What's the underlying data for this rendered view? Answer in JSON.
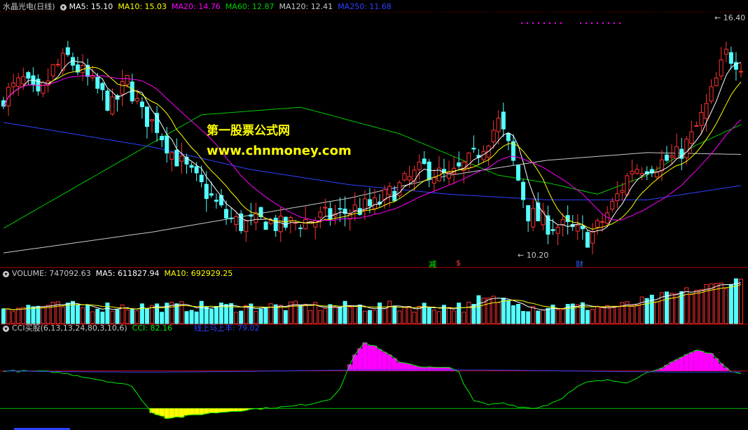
{
  "chart_data": [
    {
      "type": "candlestick",
      "title": "水晶光电(日线)",
      "indicators": [
        {
          "name": "MA5",
          "value": "15.10",
          "color": "#ffffff"
        },
        {
          "name": "MA10",
          "value": "15.03",
          "color": "#ffff00"
        },
        {
          "name": "MA20",
          "value": "14.76",
          "color": "#ff00ff"
        },
        {
          "name": "MA60",
          "value": "12.87",
          "color": "#00cc00"
        },
        {
          "name": "MA120",
          "value": "12.41",
          "color": "#c8c8c8"
        },
        {
          "name": "MA250",
          "value": "11.68",
          "color": "#3040ff"
        }
      ],
      "high_label": "16.40",
      "low_label": "10.20",
      "annotations": [
        "减",
        "$",
        "财"
      ],
      "ylim": [
        10.0,
        16.7
      ],
      "bars": 150,
      "anchors_close": [
        [
          0,
          14.5
        ],
        [
          4,
          14.9
        ],
        [
          7,
          14.4
        ],
        [
          10,
          15.2
        ],
        [
          13,
          15.5
        ],
        [
          18,
          14.8
        ],
        [
          22,
          14.2
        ],
        [
          25,
          14.9
        ],
        [
          28,
          14.0
        ],
        [
          31,
          13.7
        ],
        [
          34,
          13.0
        ],
        [
          38,
          12.4
        ],
        [
          42,
          11.8
        ],
        [
          45,
          11.3
        ],
        [
          48,
          11.1
        ],
        [
          53,
          11.2
        ],
        [
          56,
          11.05
        ],
        [
          59,
          11.15
        ],
        [
          63,
          11.25
        ],
        [
          67,
          11.35
        ],
        [
          71,
          11.5
        ],
        [
          75,
          11.6
        ],
        [
          80,
          12.1
        ],
        [
          85,
          12.6
        ],
        [
          90,
          12.3
        ],
        [
          95,
          12.85
        ],
        [
          100,
          13.8
        ],
        [
          102,
          13.15
        ],
        [
          106,
          11.4
        ],
        [
          110,
          11.1
        ],
        [
          114,
          11.0
        ],
        [
          118,
          10.75
        ],
        [
          120,
          11.0
        ],
        [
          123,
          11.6
        ],
        [
          127,
          12.6
        ],
        [
          132,
          12.7
        ],
        [
          136,
          12.9
        ],
        [
          139,
          13.4
        ],
        [
          142,
          14.2
        ],
        [
          146,
          15.6
        ],
        [
          150,
          15.3
        ]
      ],
      "ma_anchors": {
        "MA60": [
          [
            0,
            11.0
          ],
          [
            20,
            12.5
          ],
          [
            40,
            14.0
          ],
          [
            60,
            14.2
          ],
          [
            80,
            13.5
          ],
          [
            100,
            12.4
          ],
          [
            110,
            12.2
          ],
          [
            120,
            11.9
          ],
          [
            130,
            12.4
          ],
          [
            140,
            13.2
          ],
          [
            150,
            13.8
          ]
        ],
        "MA120": [
          [
            0,
            10.35
          ],
          [
            30,
            10.9
          ],
          [
            50,
            11.35
          ],
          [
            70,
            11.8
          ],
          [
            90,
            12.4
          ],
          [
            110,
            12.8
          ],
          [
            130,
            13.0
          ],
          [
            150,
            12.95
          ]
        ],
        "MA250": [
          [
            0,
            13.8
          ],
          [
            30,
            13.15
          ],
          [
            50,
            12.55
          ],
          [
            70,
            12.15
          ],
          [
            90,
            11.9
          ],
          [
            110,
            11.75
          ],
          [
            130,
            11.75
          ],
          [
            150,
            12.15
          ]
        ]
      }
    },
    {
      "type": "bar",
      "title": "VOLUME",
      "indicators": [
        {
          "name": "VOLUME",
          "value": "747092.63",
          "color": "#c8c8c8"
        },
        {
          "name": "MA5",
          "value": "611827.94",
          "color": "#ffffff"
        },
        {
          "name": "MA10",
          "value": "692929.25",
          "color": "#ffff00"
        }
      ]
    },
    {
      "type": "line",
      "title": "CCI买股(6,13,13,24,80,3,10,6)",
      "indicators": [
        {
          "name": "CCI",
          "value": "82.16",
          "color": "#00ee00"
        },
        {
          "name": "线上马上丰",
          "value": "79.02",
          "color": "#3040ff"
        }
      ],
      "cci_anchors": [
        [
          0,
          100
        ],
        [
          10,
          95
        ],
        [
          14,
          80
        ],
        [
          18,
          60
        ],
        [
          22,
          40
        ],
        [
          26,
          20
        ],
        [
          28,
          -60
        ],
        [
          30,
          -120
        ],
        [
          33,
          -150
        ],
        [
          36,
          -145
        ],
        [
          40,
          -130
        ],
        [
          44,
          -120
        ],
        [
          48,
          -110
        ],
        [
          52,
          -100
        ],
        [
          58,
          -90
        ],
        [
          62,
          -75
        ],
        [
          66,
          -50
        ],
        [
          68,
          10
        ],
        [
          71,
          190
        ],
        [
          73,
          250
        ],
        [
          75,
          230
        ],
        [
          80,
          150
        ],
        [
          85,
          120
        ],
        [
          90,
          115
        ],
        [
          92,
          100
        ],
        [
          93,
          30
        ],
        [
          95,
          -60
        ],
        [
          98,
          -80
        ],
        [
          101,
          -70
        ],
        [
          104,
          -90
        ],
        [
          107,
          -100
        ],
        [
          110,
          -80
        ],
        [
          113,
          -40
        ],
        [
          116,
          15
        ],
        [
          118,
          40
        ],
        [
          122,
          50
        ],
        [
          126,
          40
        ],
        [
          130,
          90
        ],
        [
          134,
          130
        ],
        [
          137,
          170
        ],
        [
          140,
          210
        ],
        [
          143,
          195
        ],
        [
          145,
          140
        ],
        [
          147,
          95
        ],
        [
          150,
          80
        ]
      ]
    }
  ]
}
